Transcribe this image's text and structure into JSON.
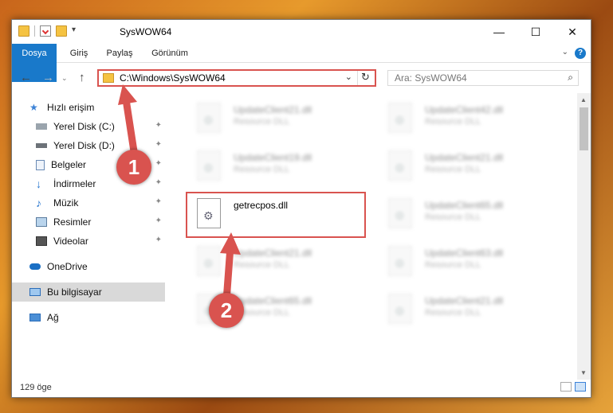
{
  "window": {
    "title": "SysWOW64"
  },
  "ribbon": {
    "tabs": [
      "Dosya",
      "Giriş",
      "Paylaş",
      "Görünüm"
    ]
  },
  "address": {
    "path": "C:\\Windows\\SysWOW64"
  },
  "search": {
    "placeholder": "Ara: SysWOW64"
  },
  "sidebar": {
    "items": [
      {
        "label": "Hızlı erişim",
        "icon": "star-icon"
      },
      {
        "label": "Yerel Disk (C:)",
        "icon": "drive-icon"
      },
      {
        "label": "Yerel Disk (D:)",
        "icon": "drive-icon"
      },
      {
        "label": "Belgeler",
        "icon": "documents-icon"
      },
      {
        "label": "İndirmeler",
        "icon": "download-icon"
      },
      {
        "label": "Müzik",
        "icon": "music-icon"
      },
      {
        "label": "Resimler",
        "icon": "pictures-icon"
      },
      {
        "label": "Videolar",
        "icon": "video-icon"
      },
      {
        "label": "OneDrive",
        "icon": "cloud-icon"
      },
      {
        "label": "Bu bilgisayar",
        "icon": "computer-icon"
      },
      {
        "label": "Ağ",
        "icon": "network-icon"
      }
    ]
  },
  "files": [
    {
      "name": "UpdateClient21.dll",
      "type": "Resource DLL"
    },
    {
      "name": "UpdateClient42.dll",
      "type": "Resource DLL"
    },
    {
      "name": "UpdateClient19.dll",
      "type": "Resource DLL"
    },
    {
      "name": "UpdateClient21.dll",
      "type": "Resource DLL"
    },
    {
      "name": "getrecpos.dll",
      "type": ""
    },
    {
      "name": "UpdateClient65.dll",
      "type": "Resource DLL"
    },
    {
      "name": "UpdateClient21.dll",
      "type": "Resource DLL"
    },
    {
      "name": "UpdateClient63.dll",
      "type": "Resource DLL"
    },
    {
      "name": "UpdateClient65.dll",
      "type": "Resource DLL"
    },
    {
      "name": "UpdateClient21.dll",
      "type": "Resource DLL"
    }
  ],
  "status": {
    "text": "129 öge"
  },
  "callouts": {
    "one": "1",
    "two": "2"
  },
  "colors": {
    "accent": "#1979ca",
    "highlight": "#d9534f"
  }
}
